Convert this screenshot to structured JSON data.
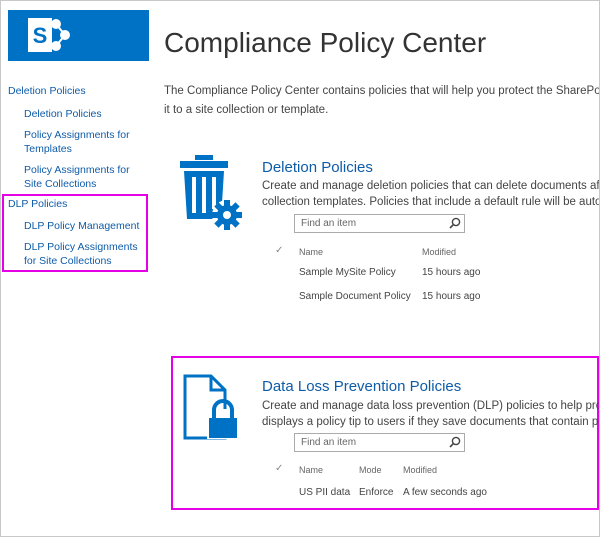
{
  "page": {
    "title": "Compliance Policy Center",
    "intro_line1": "The Compliance Policy Center contains policies that will help you protect the SharePoin",
    "intro_line2": "it to a site collection or template."
  },
  "nav": {
    "deletion_header": "Deletion Policies",
    "deletion_items": [
      "Deletion Policies",
      "Policy Assignments for Templates",
      "Policy Assignments for Site Collections"
    ],
    "dlp_header": "DLP Policies",
    "dlp_items": [
      "DLP Policy Management",
      "DLP Policy Assignments for Site Collections"
    ]
  },
  "deletion": {
    "title": "Deletion Policies",
    "desc_line1": "Create and manage deletion policies that can delete documents afte",
    "desc_line2": "collection templates. Policies that include a default rule will be autor",
    "search_placeholder": "Find an item",
    "columns": [
      "Name",
      "Modified"
    ],
    "rows": [
      {
        "name": "Sample MySite Policy",
        "modified": "15 hours ago"
      },
      {
        "name": "Sample Document Policy",
        "modified": "15 hours ago"
      }
    ]
  },
  "dlp": {
    "title": "Data Loss Prevention Policies",
    "desc_line1": "Create and manage data loss prevention (DLP) policies to help prote",
    "desc_line2": "displays a policy tip to users if they save documents that contain pe",
    "search_placeholder": "Find an item",
    "columns": [
      "Name",
      "Mode",
      "Modified"
    ],
    "rows": [
      {
        "name": "US PII data",
        "mode": "Enforce",
        "modified": "A few seconds ago"
      }
    ]
  },
  "colors": {
    "accent": "#0072c6",
    "link": "#0e5ca8",
    "highlight": "#e600e6"
  },
  "icons": [
    "sharepoint-logo-icon",
    "trash-gear-icon",
    "document-lock-icon",
    "search-icon",
    "check-icon"
  ]
}
